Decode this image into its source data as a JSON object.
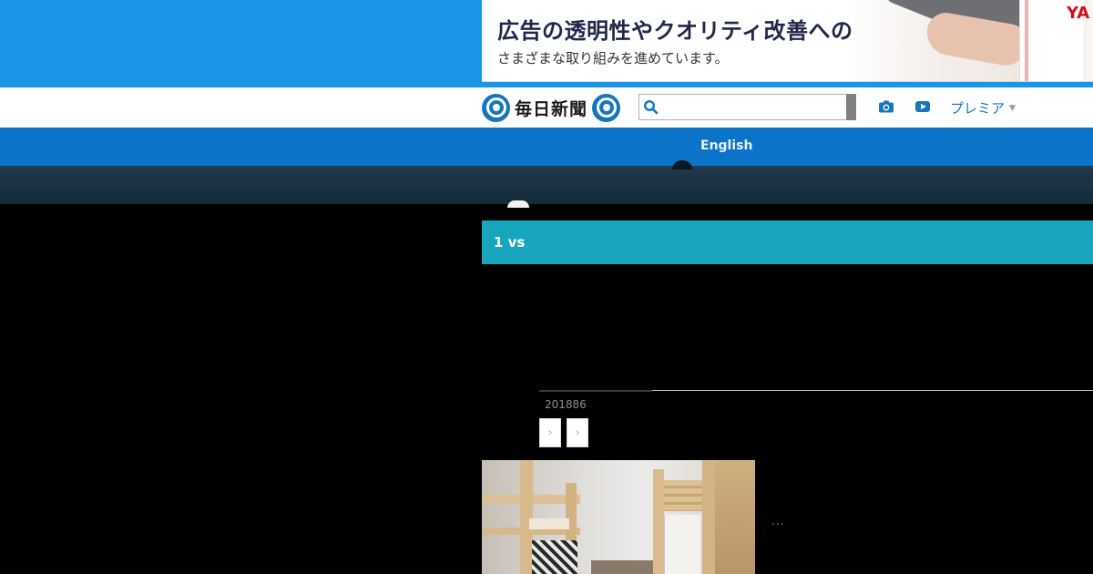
{
  "ad": {
    "headline": "広告の透明性やクオリティ改善への",
    "subline": "さまざまな取り組みを進めています。",
    "brand": "YA"
  },
  "header": {
    "logo_text": "毎日新聞",
    "search": {
      "value": "",
      "placeholder": ""
    },
    "premier_label": "プレミア",
    "icons": [
      "search-icon",
      "camera-icon",
      "video-play-icon",
      "caret-down-icon"
    ]
  },
  "nav": {
    "english_label": "English"
  },
  "article": {
    "match_label": "1  vs",
    "date": "201886",
    "photo_caption": "..."
  },
  "colors": {
    "top_band": "#1a95e8",
    "nav": "#0c74c8",
    "match_bar": "#17a6bd",
    "brand_blue": "#1576bc"
  }
}
